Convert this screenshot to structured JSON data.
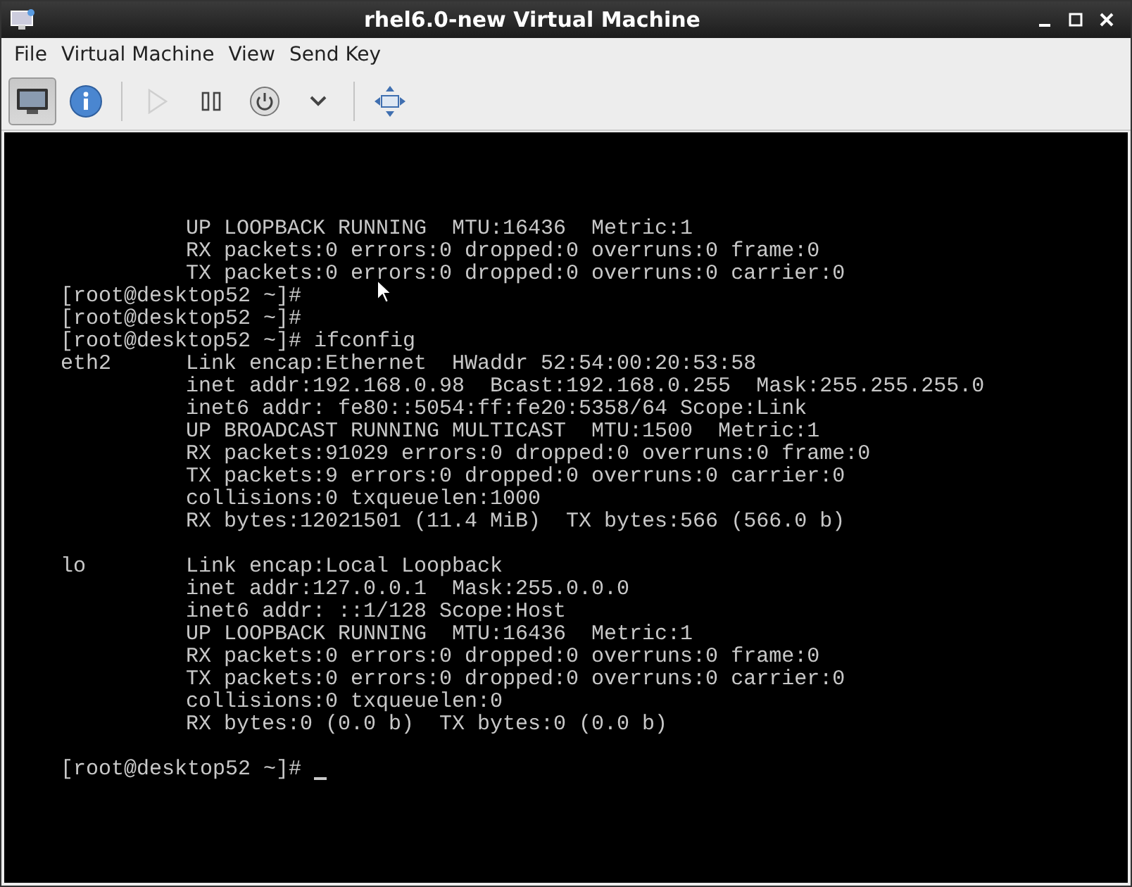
{
  "window": {
    "title": "rhel6.0-new Virtual Machine"
  },
  "menu": [
    "File",
    "Virtual Machine",
    "View",
    "Send Key"
  ],
  "toolbar": [
    {
      "kind": "console",
      "selected": true,
      "disabled": false
    },
    {
      "kind": "details",
      "selected": false,
      "disabled": false
    },
    {
      "kind": "separator"
    },
    {
      "kind": "run",
      "selected": false,
      "disabled": true
    },
    {
      "kind": "pause",
      "selected": false,
      "disabled": false
    },
    {
      "kind": "shutdown",
      "selected": false,
      "disabled": false
    },
    {
      "kind": "dropdown",
      "selected": false,
      "disabled": false
    },
    {
      "kind": "separator"
    },
    {
      "kind": "fullscreen",
      "selected": false,
      "disabled": false
    }
  ],
  "console": {
    "lines": [
      {
        "text": "UP LOOPBACK RUNNING  MTU:16436  Metric:1"
      },
      {
        "text": "RX packets:0 errors:0 dropped:0 overruns:0 frame:0"
      },
      {
        "text": "TX packets:0 errors:0 dropped:0 overruns:0 carrier:0"
      },
      {
        "prompt": "[root@desktop52 ~]#"
      },
      {
        "prompt": "[root@desktop52 ~]#"
      },
      {
        "prompt": "[root@desktop52 ~]# ifconfig"
      },
      {
        "label": "eth2",
        "text": "Link encap:Ethernet  HWaddr 52:54:00:20:53:58"
      },
      {
        "text": "inet addr:192.168.0.98  Bcast:192.168.0.255  Mask:255.255.255.0"
      },
      {
        "text": "inet6 addr: fe80::5054:ff:fe20:5358/64 Scope:Link"
      },
      {
        "text": "UP BROADCAST RUNNING MULTICAST  MTU:1500  Metric:1"
      },
      {
        "text": "RX packets:91029 errors:0 dropped:0 overruns:0 frame:0"
      },
      {
        "text": "TX packets:9 errors:0 dropped:0 overruns:0 carrier:0"
      },
      {
        "text": "collisions:0 txqueuelen:1000"
      },
      {
        "text": "RX bytes:12021501 (11.4 MiB)  TX bytes:566 (566.0 b)"
      },
      {
        "kind": "blank"
      },
      {
        "label": "lo",
        "text": "Link encap:Local Loopback"
      },
      {
        "text": "inet addr:127.0.0.1  Mask:255.0.0.0"
      },
      {
        "text": "inet6 addr: ::1/128 Scope:Host"
      },
      {
        "text": "UP LOOPBACK RUNNING  MTU:16436  Metric:1"
      },
      {
        "text": "RX packets:0 errors:0 dropped:0 overruns:0 frame:0"
      },
      {
        "text": "TX packets:0 errors:0 dropped:0 overruns:0 carrier:0"
      },
      {
        "text": "collisions:0 txqueuelen:0"
      },
      {
        "text": "RX bytes:0 (0.0 b)  TX bytes:0 (0.0 b)"
      },
      {
        "kind": "blank"
      },
      {
        "prompt": "[root@desktop52 ~]#",
        "cursor": true
      }
    ]
  }
}
